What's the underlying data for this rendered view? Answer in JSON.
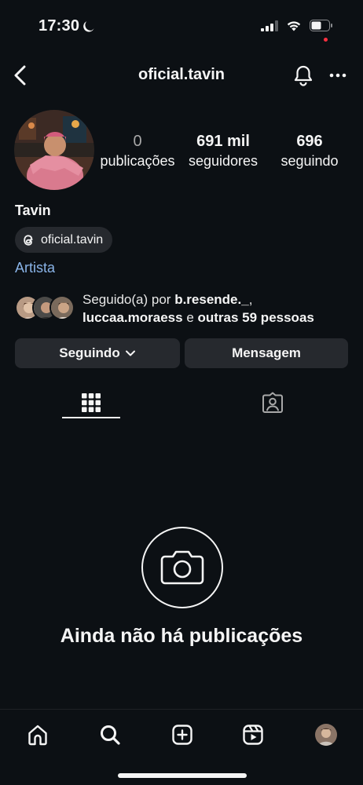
{
  "status_bar": {
    "time": "17:30"
  },
  "header": {
    "username": "oficial.tavin"
  },
  "stats": [
    {
      "value": "0",
      "label": "publicações"
    },
    {
      "value": "691 mil",
      "label": "seguidores"
    },
    {
      "value": "696",
      "label": "seguindo"
    }
  ],
  "profile": {
    "name": "Tavin",
    "threads_handle": "oficial.tavin",
    "category": "Artista"
  },
  "followed_by": {
    "prefix": "Seguido(a) por ",
    "user1": "b.resende._",
    "sep": ",",
    "user2": "luccaa.moraess",
    "middle": " e ",
    "others": "outras 59 pessoas"
  },
  "buttons": {
    "following": "Seguindo",
    "message": "Mensagem"
  },
  "empty_state": {
    "text": "Ainda não há publicações"
  },
  "colors": {
    "background": "#0c1014",
    "button": "#26292e",
    "link": "#8ab4e8",
    "notification_dot": "#ff3040"
  },
  "icons": {
    "status": [
      "moon-icon",
      "signal-icon",
      "wifi-icon",
      "battery-icon"
    ],
    "header": [
      "back-icon",
      "bell-icon",
      "more-icon"
    ],
    "tabs": [
      "grid-icon",
      "tagged-icon"
    ],
    "nav": [
      "home-icon",
      "search-icon",
      "create-icon",
      "reels-icon",
      "profile-avatar"
    ]
  }
}
